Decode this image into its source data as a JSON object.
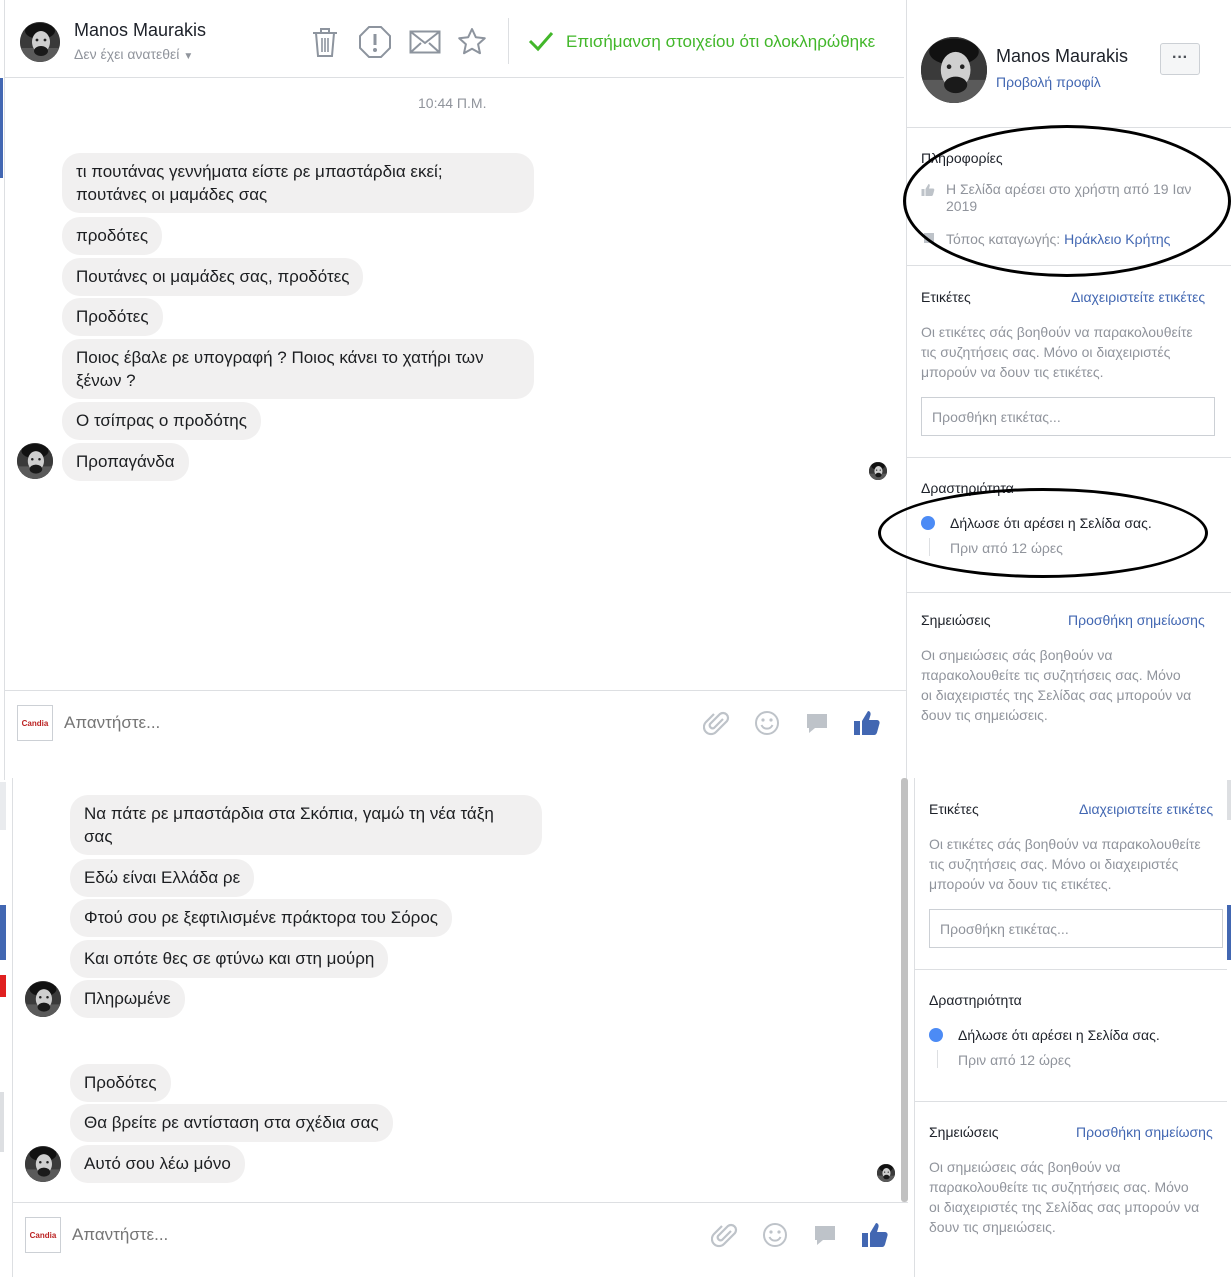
{
  "header": {
    "name": "Manos Maurakis",
    "assignment": "Δεν έχει ανατεθεί",
    "done_label": "Επισήμανση στοιχείου ότι ολοκληρώθηκε"
  },
  "thread1": {
    "timestamp": "10:44 Π.Μ.",
    "messages": [
      "τι πουτάνας γεννήματα είστε ρε μπαστάρδια εκεί;\nπουτάνες οι μαμάδες σας",
      "προδότες",
      "Πουτάνες οι μαμάδες σας, προδότες",
      "Προδότες",
      "Ποιος έβαλε ρε υπογραφή ? Ποιος κάνει το χατήρι των\nξένων ?",
      "Ο τσίπρας ο προδότης",
      "Προπαγάνδα"
    ]
  },
  "thread2": {
    "messages": [
      "Να πάτε ρε μπαστάρδια στα Σκόπια, γαμώ τη νέα τάξη\nσας",
      "Εδώ είναι Ελλάδα ρε",
      "Φτού σου ρε ξεφτιλισμένε πράκτορα του Σόρος",
      "Και οπότε θες σε φτύνω και στη μούρη",
      "Πληρωμένε",
      "Προδότες",
      "Θα βρείτε ρε αντίσταση στα σχέδια σας",
      "Αυτό σου λέω μόνο"
    ]
  },
  "composer": {
    "placeholder": "Απαντήστε...",
    "page_logo_text": "Candia"
  },
  "profile": {
    "name": "Manos Maurakis",
    "view_profile": "Προβολή προφίλ",
    "more": "···"
  },
  "info": {
    "title": "Πληροφορίες",
    "liked_text": "Η Σελίδα αρέσει στο χρήστη από 19 Ιαν\n2019",
    "location_label": "Τόπος καταγωγής: ",
    "location_value": "Ηράκλειο Κρήτης"
  },
  "labels": {
    "title": "Ετικέτες",
    "manage": "Διαχειριστείτε ετικέτες",
    "description": "Οι ετικέτες σάς βοηθούν να παρακολουθείτε\nτις συζητήσεις σας. Μόνο οι διαχειριστές\nμπορούν να δουν τις ετικέτες.",
    "placeholder": "Προσθήκη ετικέτας..."
  },
  "activity": {
    "title": "Δραστηριότητα",
    "event": "Δήλωσε ότι αρέσει η Σελίδα σας.",
    "time": "Πριν από 12 ώρες"
  },
  "notes": {
    "title": "Σημειώσεις",
    "add": "Προσθήκη σημείωσης",
    "description": "Οι σημειώσεις σάς βοηθούν να\nπαρακολουθείτε τις συζητήσεις σας. Μόνο\nοι διαχειριστές της Σελίδας σας μπορούν να\nδουν τις σημειώσεις."
  },
  "colors": {
    "accent": "#4267b2",
    "done_green": "#42b72a",
    "bubble": "#f1f0f0",
    "activity_dot": "#4c8bf5"
  },
  "icons": [
    "trash-icon",
    "report-icon",
    "envelope-icon",
    "star-icon",
    "check-icon",
    "paperclip-icon",
    "emoji-icon",
    "sticker-icon",
    "thumbs-up-icon",
    "more-icon"
  ]
}
